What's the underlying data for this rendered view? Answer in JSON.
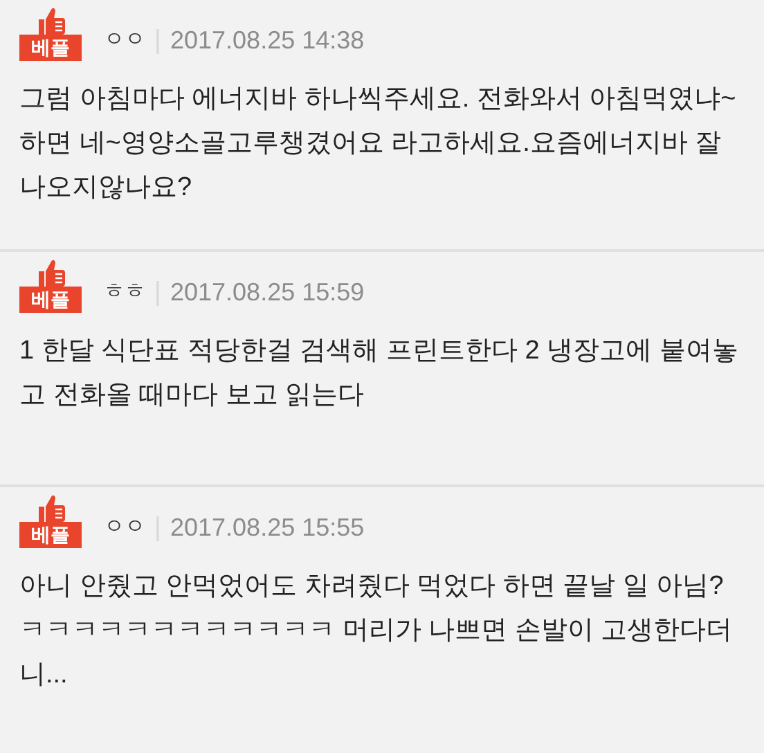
{
  "comments": [
    {
      "badge": "베플",
      "author": "ㅇㅇ",
      "date": "2017.08.25 14:38",
      "text": "그럼 아침마다 에너지바 하나씩주세요. 전화와서 아침먹였냐~하면 네~영양소골고루챙겼어요 라고하세요.요즘에너지바 잘나오지않나요?"
    },
    {
      "badge": "베플",
      "author": "ㅎㅎ",
      "date": "2017.08.25 15:59",
      "text": "1 한달 식단표 적당한걸 검색해 프린트한다 2 냉장고에 붙여놓고 전화올 때마다 보고 읽는다"
    },
    {
      "badge": "베플",
      "author": "ㅇㅇ",
      "date": "2017.08.25 15:55",
      "text": "아니 안줬고 안먹었어도 차려줬다 먹었다 하면 끝날 일 아님? ㅋㅋㅋㅋㅋㅋㅋㅋㅋㅋㅋㅋ 머리가 나쁘면 손발이 고생한다더니..."
    }
  ]
}
